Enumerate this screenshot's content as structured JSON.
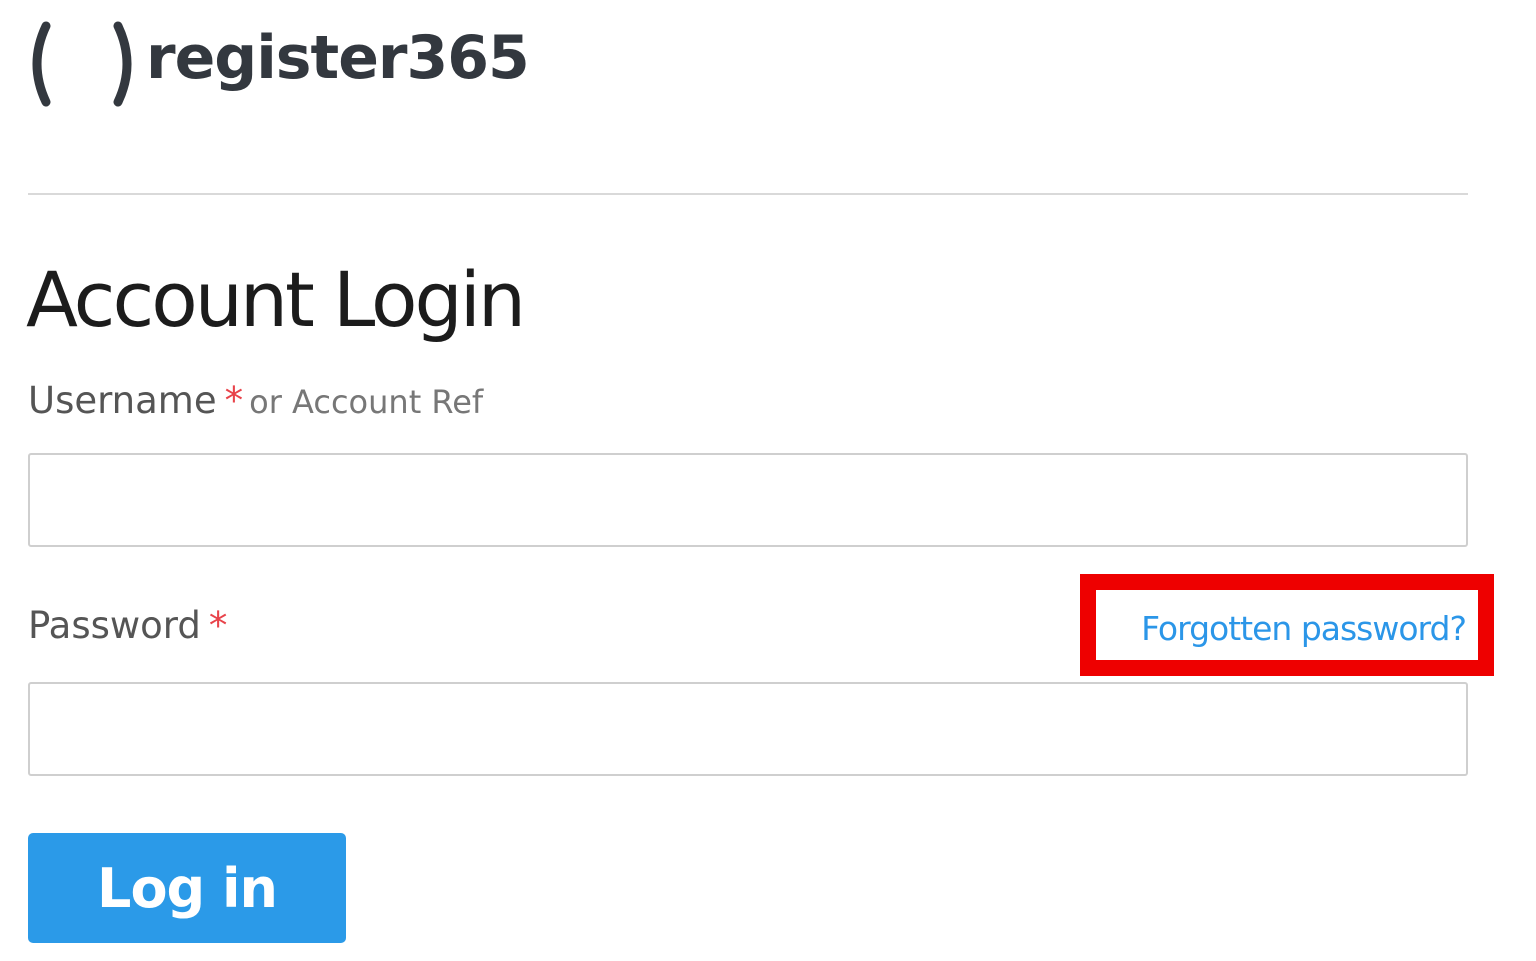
{
  "brand": {
    "logo_text": "register365"
  },
  "page": {
    "title": "Account Login"
  },
  "username_field": {
    "label": "Username",
    "required_marker": "*",
    "hint": "or Account Ref",
    "value": "",
    "placeholder": ""
  },
  "password_field": {
    "label": "Password",
    "required_marker": "*",
    "value": "",
    "placeholder": ""
  },
  "links": {
    "forgot_password": "Forgotten password?"
  },
  "actions": {
    "login_label": "Log in"
  },
  "colors": {
    "accent": "#2b9ae8",
    "link": "#2b96e8",
    "required": "#e8434a",
    "highlight": "#ee0000"
  },
  "icons": {
    "logo_mark": "bracket-logo-icon"
  }
}
